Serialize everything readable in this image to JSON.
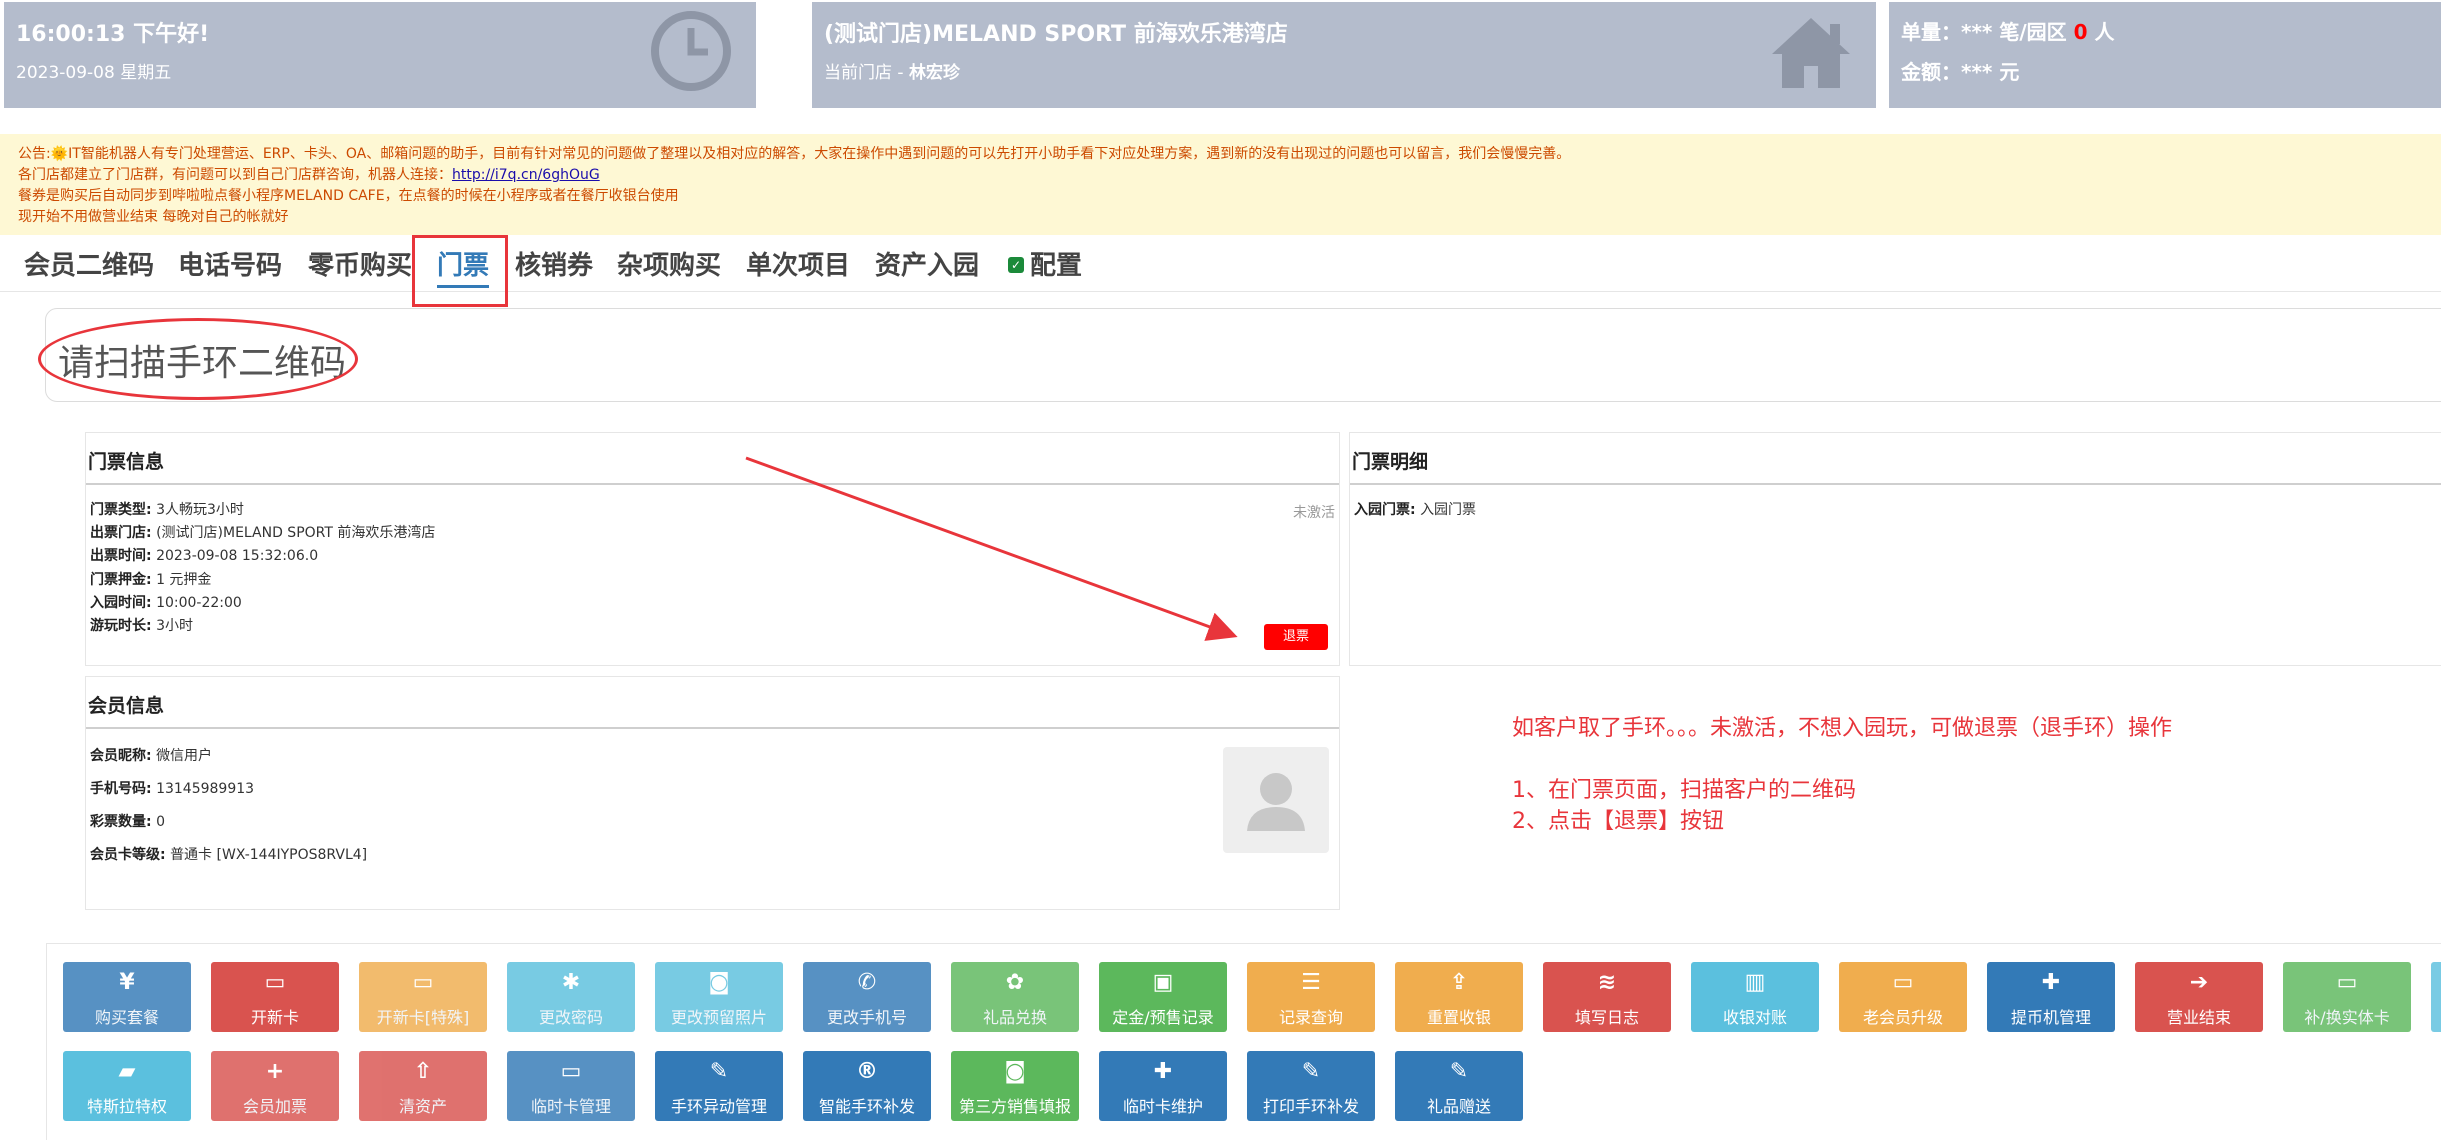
{
  "header": {
    "clock_card": {
      "time_greeting": "16:00:13 下午好!",
      "date": "2023-09-08 星期五"
    },
    "store_card": {
      "store_name": "(测试门店)MELAND SPORT 前海欢乐港湾店",
      "current_store_label": "当前门店 - ",
      "current_store_user": "林宏珍"
    },
    "stats_card": {
      "orders_prefix": "单量：*** 笔/园区 ",
      "orders_count": "0",
      "orders_suffix": " 人",
      "amount": "金额：*** 元"
    }
  },
  "notice": {
    "line1": "公告:🌞IT智能机器人有专门处理营运、ERP、卡头、OA、邮箱问题的助手，目前有针对常见的问题做了整理以及相对应的解答，大家在操作中遇到问题的可以先打开小助手看下对应处理方案，遇到新的没有出现过的问题也可以留言，我们会慢慢完善。",
    "line2_text": "各门店都建立了门店群，有问题可以到自己门店群咨询，机器人连接：",
    "line2_link": "http://i7q.cn/6ghOuG",
    "line3": "餐券是购买后自动同步到哔啦啦点餐小程序MELAND CAFE，在点餐的时候在小程序或者在餐厅收银台使用",
    "line4": "现开始不用做营业结束 每晚对自己的帐就好"
  },
  "tabs": [
    "会员二维码",
    "电话号码",
    "零币购买",
    "门票",
    "核销券",
    "杂项购买",
    "单次项目",
    "资产入园",
    "配置"
  ],
  "active_tab": "门票",
  "scan": {
    "prompt": "请扫描手环二维码"
  },
  "ticket_info": {
    "title": "门票信息",
    "status": "未激活",
    "fields": [
      {
        "label": "门票类型:",
        "value": "3人畅玩3小时"
      },
      {
        "label": "出票门店:",
        "value": "(测试门店)MELAND SPORT 前海欢乐港湾店"
      },
      {
        "label": "出票时间:",
        "value": "2023-09-08 15:32:06.0"
      },
      {
        "label": "门票押金:",
        "value": "1 元押金"
      },
      {
        "label": "入园时间:",
        "value": "10:00-22:00"
      },
      {
        "label": "游玩时长:",
        "value": "3小时"
      }
    ],
    "refund_button": "退票"
  },
  "ticket_detail": {
    "title": "门票明细",
    "fields": [
      {
        "label": "入园门票:",
        "value": "入园门票"
      }
    ]
  },
  "member_info": {
    "title": "会员信息",
    "fields": [
      {
        "label": "会员昵称:",
        "value": "微信用户"
      },
      {
        "label": "手机号码:",
        "value": "13145989913"
      },
      {
        "label": "彩票数量:",
        "value": "0"
      },
      {
        "label": "会员卡等级:",
        "value": "普通卡 [WX-144IYPOS8RVL4]"
      }
    ]
  },
  "annotation": {
    "line1": "如客户取了手环。。。未激活，不想入园玩，可做退票（退手环）操作",
    "line2": "1、在门票页面，扫描客户的二维码",
    "line3": "2、点击【退票】按钮"
  },
  "colors": {
    "blue": "#337ab7",
    "red": "#d9534f",
    "orange": "#f0ad4e",
    "cyan": "#5bc0de",
    "green": "#5cb85c",
    "header_bg": "#b4bccc",
    "notice_bg": "#fef8d4"
  },
  "action_buttons": {
    "row1": [
      {
        "label": "购买套餐",
        "icon": "yen-icon",
        "glyph": "¥",
        "color": "#337ab7",
        "faded": true
      },
      {
        "label": "开新卡",
        "icon": "card-icon",
        "glyph": "▭",
        "color": "#d9534f",
        "faded": false
      },
      {
        "label": "开新卡[特殊]",
        "icon": "card-icon",
        "glyph": "▭",
        "color": "#f0ad4e",
        "faded": true
      },
      {
        "label": "更改密码",
        "icon": "asterisk-icon",
        "glyph": "✱",
        "color": "#5bc0de",
        "faded": true
      },
      {
        "label": "更改预留照片",
        "icon": "camera-icon",
        "glyph": "◙",
        "color": "#5bc0de",
        "faded": true
      },
      {
        "label": "更改手机号",
        "icon": "phone-icon",
        "glyph": "✆",
        "color": "#337ab7",
        "faded": true
      },
      {
        "label": "礼品兑换",
        "icon": "gift-icon",
        "glyph": "✿",
        "color": "#5cb85c",
        "faded": true
      },
      {
        "label": "定金/预售记录",
        "icon": "money-icon",
        "glyph": "▣",
        "color": "#5cb85c",
        "faded": false
      },
      {
        "label": "记录查询",
        "icon": "list-icon",
        "glyph": "☰",
        "color": "#f0ad4e",
        "faded": false
      },
      {
        "label": "重置收银",
        "icon": "share-icon",
        "glyph": "⇪",
        "color": "#f0ad4e",
        "faded": false
      },
      {
        "label": "填写日志",
        "icon": "stack-icon",
        "glyph": "≋",
        "color": "#d9534f",
        "faded": false
      },
      {
        "label": "收银对账",
        "icon": "bar-chart-icon",
        "glyph": "▥",
        "color": "#5bc0de",
        "faded": false
      },
      {
        "label": "老会员升级",
        "icon": "card-icon",
        "glyph": "▭",
        "color": "#f0ad4e",
        "faded": false
      },
      {
        "label": "提币机管理",
        "icon": "gamepad-icon",
        "glyph": "✚",
        "color": "#337ab7",
        "faded": false
      },
      {
        "label": "营业结束",
        "icon": "sign-in-icon",
        "glyph": "➔",
        "color": "#d9534f",
        "faded": false
      },
      {
        "label": "补/换实体卡",
        "icon": "card-icon",
        "glyph": "▭",
        "color": "#5cb85c",
        "faded": true
      },
      {
        "label": "",
        "icon": "card-icon",
        "glyph": "",
        "color": "#5bc0de",
        "faded": true
      }
    ],
    "row2": [
      {
        "label": "特斯拉特权",
        "icon": "car-icon",
        "glyph": "▰",
        "color": "#5bc0de",
        "faded": false
      },
      {
        "label": "会员加票",
        "icon": "plus-icon",
        "glyph": "+",
        "color": "#d9534f",
        "faded": true
      },
      {
        "label": "清资产",
        "icon": "upload-icon",
        "glyph": "⇧",
        "color": "#d9534f",
        "faded": true
      },
      {
        "label": "临时卡管理",
        "icon": "card-icon",
        "glyph": "▭",
        "color": "#337ab7",
        "faded": true
      },
      {
        "label": "手环异动管理",
        "icon": "edit-icon",
        "glyph": "✎",
        "color": "#337ab7",
        "faded": false
      },
      {
        "label": "智能手环补发",
        "icon": "registered-icon",
        "glyph": "®",
        "color": "#337ab7",
        "faded": false
      },
      {
        "label": "第三方销售填报",
        "icon": "rss-icon",
        "glyph": "◙",
        "color": "#5cb85c",
        "faded": false
      },
      {
        "label": "临时卡维护",
        "icon": "gamepad-icon",
        "glyph": "✚",
        "color": "#337ab7",
        "faded": false
      },
      {
        "label": "打印手环补发",
        "icon": "pencil-icon",
        "glyph": "✎",
        "color": "#337ab7",
        "faded": false
      },
      {
        "label": "礼品赠送",
        "icon": "pencil-icon",
        "glyph": "✎",
        "color": "#337ab7",
        "faded": false
      }
    ]
  }
}
